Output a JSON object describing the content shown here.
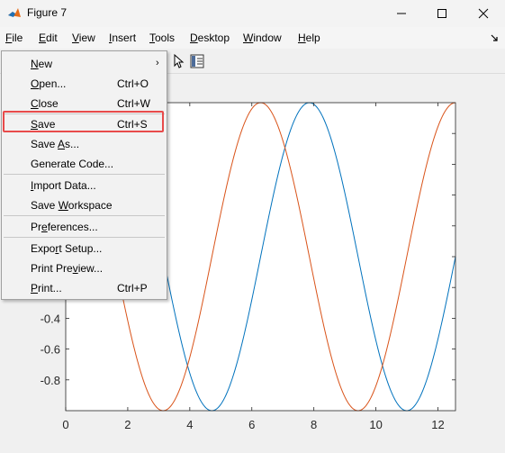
{
  "window": {
    "title": "Figure 7",
    "controls": [
      "minimize-icon",
      "maximize-icon",
      "close-icon"
    ]
  },
  "menubar": {
    "items": [
      {
        "pre": "",
        "ul": "F",
        "post": "ile"
      },
      {
        "pre": "",
        "ul": "E",
        "post": "dit"
      },
      {
        "pre": "",
        "ul": "V",
        "post": "iew"
      },
      {
        "pre": "",
        "ul": "I",
        "post": "nsert"
      },
      {
        "pre": "",
        "ul": "T",
        "post": "ools"
      },
      {
        "pre": "",
        "ul": "D",
        "post": "esktop"
      },
      {
        "pre": "",
        "ul": "W",
        "post": "indow"
      },
      {
        "pre": "",
        "ul": "H",
        "post": "elp"
      }
    ],
    "dock_icon": "dock-arrow-icon"
  },
  "toolbar": {
    "icons": [
      "edit-plot-icon",
      "property-inspector-icon"
    ]
  },
  "file_menu": {
    "items": [
      {
        "pre": "",
        "ul": "N",
        "post": "ew",
        "shortcut": "",
        "submenu": true,
        "arrow": "›"
      },
      {
        "pre": "",
        "ul": "O",
        "post": "pen...",
        "shortcut": "Ctrl+O",
        "submenu": false
      },
      {
        "pre": "",
        "ul": "C",
        "post": "lose",
        "shortcut": "Ctrl+W",
        "submenu": false
      },
      {
        "pre": "",
        "ul": "S",
        "post": "ave",
        "shortcut": "Ctrl+S",
        "submenu": false,
        "highlighted": true
      },
      {
        "pre": "Save ",
        "ul": "A",
        "post": "s...",
        "shortcut": "",
        "submenu": false
      },
      {
        "pre": "Generate Code...",
        "ul": "",
        "post": "",
        "shortcut": "",
        "submenu": false
      },
      {
        "pre": "",
        "ul": "I",
        "post": "mport Data...",
        "shortcut": "",
        "submenu": false
      },
      {
        "pre": "Save ",
        "ul": "W",
        "post": "orkspace",
        "shortcut": "",
        "submenu": false
      },
      {
        "pre": "Pr",
        "ul": "e",
        "post": "ferences...",
        "shortcut": "",
        "submenu": false
      },
      {
        "pre": "Expo",
        "ul": "r",
        "post": "t Setup...",
        "shortcut": "",
        "submenu": false
      },
      {
        "pre": "Print Pre",
        "ul": "v",
        "post": "iew...",
        "shortcut": "",
        "submenu": false
      },
      {
        "pre": "",
        "ul": "P",
        "post": "rint...",
        "shortcut": "Ctrl+P",
        "submenu": false
      }
    ]
  },
  "chart_data": {
    "type": "line",
    "title": "",
    "xlabel": "",
    "ylabel": "",
    "xlim": [
      0,
      12.566
    ],
    "ylim": [
      -1,
      1
    ],
    "xticks": [
      0,
      2,
      4,
      6,
      8,
      10,
      12
    ],
    "xtick_labels": [
      "0",
      "2",
      "4",
      "6",
      "8",
      "10",
      "12"
    ],
    "yticks": [
      -0.8,
      -0.6,
      -0.4
    ],
    "ytick_labels": [
      "-0.8",
      "-0.6",
      "-0.4"
    ],
    "grid": false,
    "series": [
      {
        "color": "#0072BD",
        "function": "sin(x)",
        "x_range": [
          0,
          12.566
        ]
      },
      {
        "color": "#D95319",
        "function": "cos(x)",
        "x_range": [
          0,
          12.566
        ]
      }
    ]
  }
}
